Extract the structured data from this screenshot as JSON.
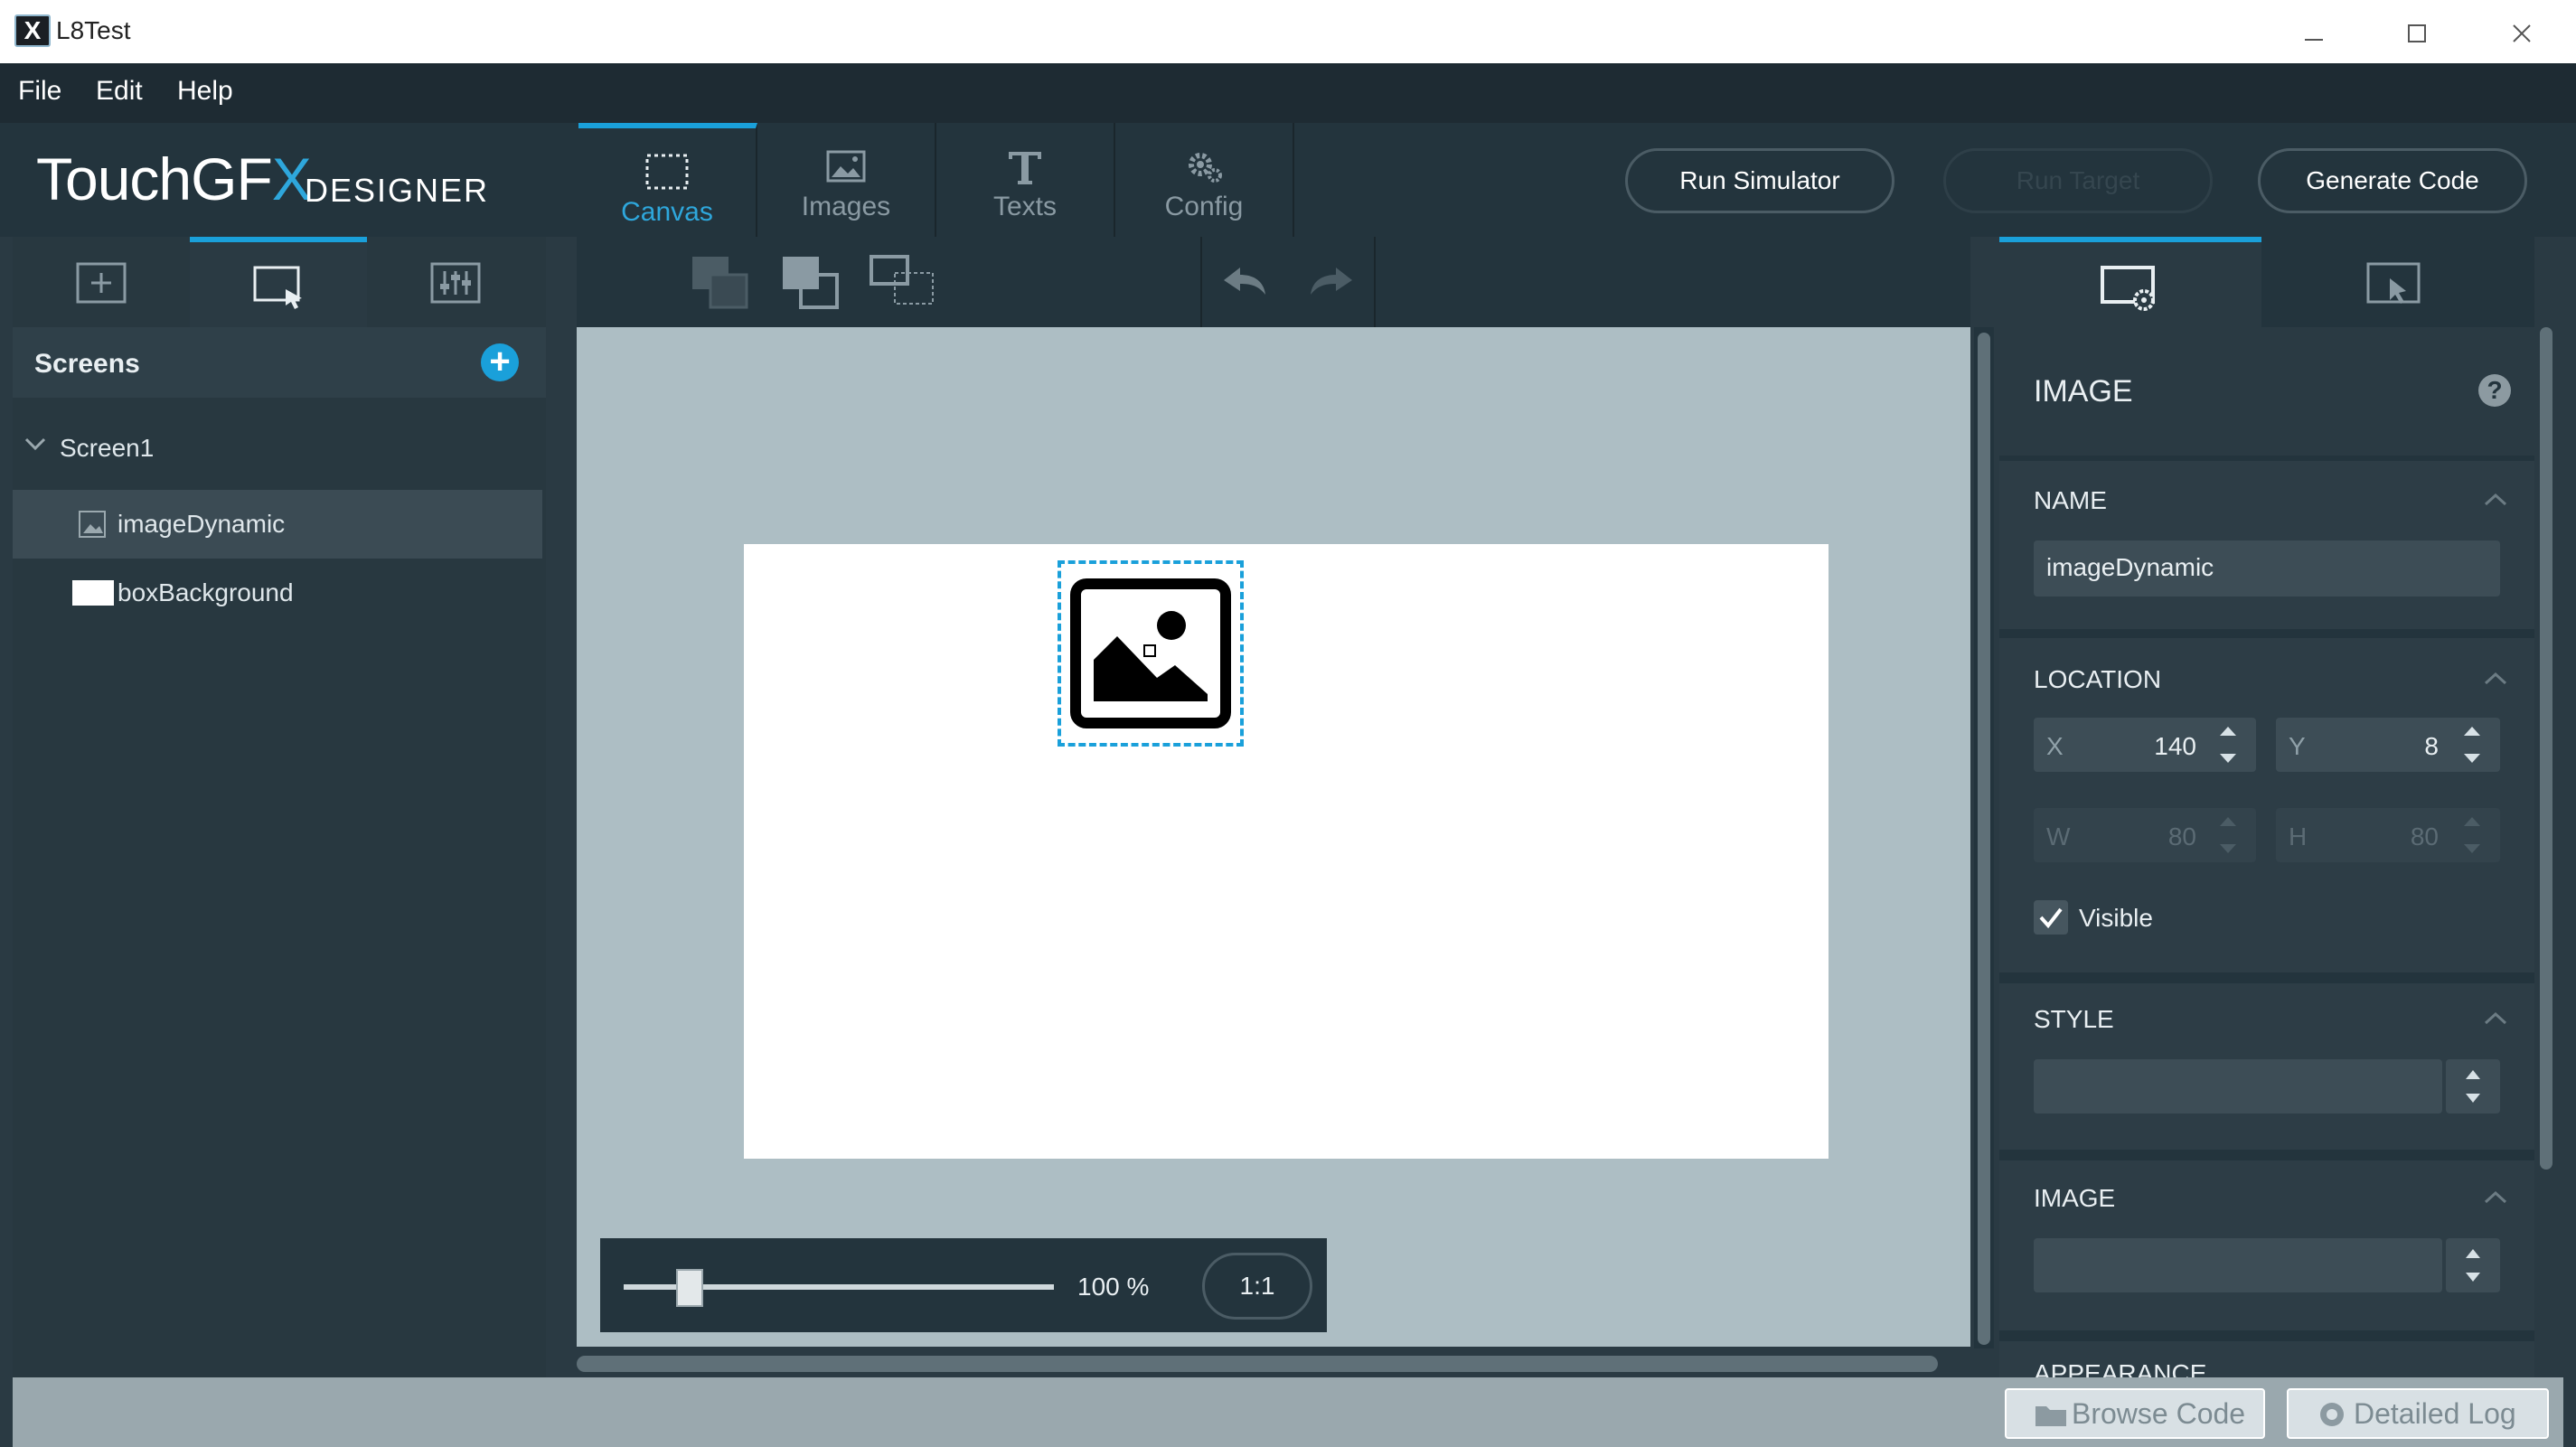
{
  "window": {
    "title": "L8Test",
    "app_icon_letter": "X"
  },
  "menu": [
    "File",
    "Edit",
    "Help"
  ],
  "header": {
    "logo_main": "TouchGF",
    "logo_x": "X",
    "logo_sub": "DESIGNER",
    "tabs": [
      {
        "label": "Canvas",
        "icon": "canvas-icon",
        "active": true
      },
      {
        "label": "Images",
        "icon": "images-icon",
        "active": false
      },
      {
        "label": "Texts",
        "icon": "texts-icon",
        "active": false
      },
      {
        "label": "Config",
        "icon": "config-icon",
        "active": false
      }
    ],
    "buttons": {
      "run_simulator": "Run Simulator",
      "run_target": "Run Target",
      "generate_code": "Generate Code"
    }
  },
  "sidebar": {
    "tabs": [
      "add-widget-icon",
      "screens-tree-icon",
      "interactions-icon"
    ],
    "screens_title": "Screens",
    "add_symbol": "+",
    "tree": {
      "screen": "Screen1",
      "widgets": [
        {
          "label": "imageDynamic",
          "icon": "image-thumb-icon",
          "selected": true
        },
        {
          "label": "boxBackground",
          "icon": "box-swatch-icon",
          "selected": false
        }
      ]
    }
  },
  "canvas": {
    "zoom_value": "100 %",
    "zoom_reset": "1:1",
    "zoom_fraction": 0.13,
    "toolbar_icons": [
      "send-back-icon",
      "bring-front-icon",
      "group-icon",
      "undo-icon",
      "redo-icon"
    ]
  },
  "properties": {
    "title": "IMAGE",
    "help": "?",
    "name_section": "NAME",
    "name_value": "imageDynamic",
    "location_section": "LOCATION",
    "x_label": "X",
    "x_value": "140",
    "y_label": "Y",
    "y_value": "8",
    "w_label": "W",
    "w_value": "80",
    "h_label": "H",
    "h_value": "80",
    "visible_label": "Visible",
    "visible_checked": true,
    "style_section": "STYLE",
    "image_section": "IMAGE",
    "appearance_section": "APPEARANCE"
  },
  "status": {
    "browse_code": "Browse Code",
    "detailed_log": "Detailed Log"
  },
  "colors": {
    "accent": "#1aa0da",
    "panel": "#23343d",
    "canvas_bg": "#adbec4"
  }
}
